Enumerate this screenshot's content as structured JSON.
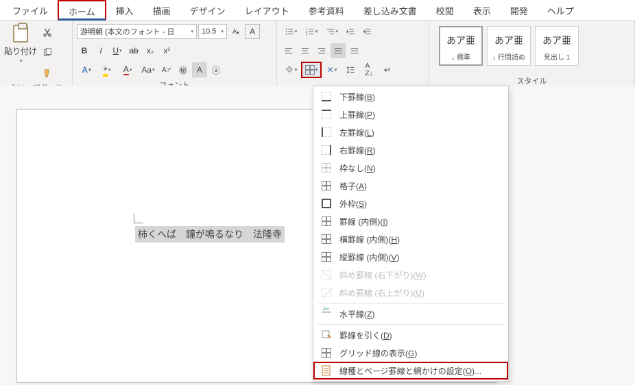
{
  "menu": {
    "items": [
      "ファイル",
      "ホーム",
      "挿入",
      "描画",
      "デザイン",
      "レイアウト",
      "参考資料",
      "差し込み文書",
      "校閲",
      "表示",
      "開発",
      "ヘルプ"
    ],
    "active_index": 1
  },
  "ribbon": {
    "clipboard": {
      "label": "クリップボード",
      "paste": "貼り付け"
    },
    "font": {
      "label": "フォント",
      "name": "游明朝 (本文のフォント - 日",
      "size": "10.5"
    },
    "styles": {
      "label": "スタイル",
      "items": [
        {
          "preview": "あア亜",
          "name": "↓ 標準",
          "selected": true
        },
        {
          "preview": "あア亜",
          "name": "↓ 行間詰め",
          "selected": false
        },
        {
          "preview": "あア亜",
          "name": "見出し 1",
          "selected": false
        }
      ]
    }
  },
  "document": {
    "text": "柿くへば　鐘が鳴るなり　法隆寺"
  },
  "border_menu": {
    "items": [
      {
        "label": "下罫線(",
        "acc": "B",
        "tail": ")",
        "icon": "bottom"
      },
      {
        "label": "上罫線(",
        "acc": "P",
        "tail": ")",
        "icon": "top"
      },
      {
        "label": "左罫線(",
        "acc": "L",
        "tail": ")",
        "icon": "left"
      },
      {
        "label": "右罫線(",
        "acc": "R",
        "tail": ")",
        "icon": "right"
      },
      {
        "label": "枠なし(",
        "acc": "N",
        "tail": ")",
        "icon": "none"
      },
      {
        "label": "格子(",
        "acc": "A",
        "tail": ")",
        "icon": "grid"
      },
      {
        "label": "外枠(",
        "acc": "S",
        "tail": ")",
        "icon": "box"
      },
      {
        "label": "罫線 (内側)(",
        "acc": "I",
        "tail": ")",
        "icon": "inside"
      },
      {
        "label": "横罫線 (内側)(",
        "acc": "H",
        "tail": ")",
        "icon": "hinside"
      },
      {
        "label": "縦罫線 (内側)(",
        "acc": "V",
        "tail": ")",
        "icon": "vinside"
      },
      {
        "label": "斜め罫線 (右下がり)(",
        "acc": "W",
        "tail": ")",
        "icon": "diag-down",
        "disabled": true
      },
      {
        "label": "斜め罫線 (右上がり)(",
        "acc": "U",
        "tail": ")",
        "icon": "diag-up",
        "disabled": true
      },
      {
        "sep": true
      },
      {
        "label": "水平線(",
        "acc": "Z",
        "tail": ")",
        "icon": "hr"
      },
      {
        "sep": true
      },
      {
        "label": "罫線を引く(",
        "acc": "D",
        "tail": ")",
        "icon": "draw"
      },
      {
        "label": "グリッド線の表示(",
        "acc": "G",
        "tail": ")",
        "icon": "gridlines"
      },
      {
        "label": "線種とページ罫線と網かけの設定(",
        "acc": "O",
        "tail": ")...",
        "icon": "settings",
        "highlight": true
      }
    ]
  }
}
